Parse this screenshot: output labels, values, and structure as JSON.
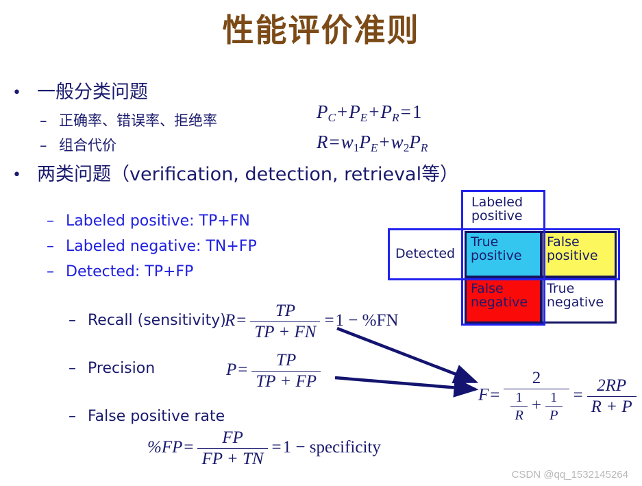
{
  "slide": {
    "title": "性能评价准则",
    "title_color": "#7b4a17",
    "body_color": "#1a1a6e",
    "accent_blue": "#2020e0"
  },
  "bullets": {
    "level1": [
      {
        "marker": "•",
        "text": "一般分类问题"
      },
      {
        "marker": "•",
        "text": "两类问题（verification, detection, retrieval等）"
      }
    ],
    "group_a": [
      {
        "marker": "–",
        "text": "正确率、错误率、拒绝率"
      },
      {
        "marker": "–",
        "text": "组合代价"
      }
    ],
    "group_b": [
      {
        "marker": "–",
        "text": "Labeled positive: TP+FN"
      },
      {
        "marker": "–",
        "text": "Labeled negative: TN+FP"
      },
      {
        "marker": "–",
        "text": "Detected: TP+FP"
      }
    ],
    "group_c": [
      {
        "marker": "–",
        "text": "Recall (sensitivity)"
      },
      {
        "marker": "–",
        "text": "Precision"
      },
      {
        "marker": "–",
        "text": "False positive rate"
      }
    ]
  },
  "formulas": {
    "sum_identity": {
      "lhs1": "P",
      "sub1": "C",
      "lhs2": "P",
      "sub2": "E",
      "lhs3": "P",
      "sub3": "R",
      "rhs": "1",
      "plain": "P_C + P_E + P_R = 1"
    },
    "combined_cost": {
      "lhs": "R",
      "w1": "w",
      "w1sub": "1",
      "p1": "P",
      "p1sub": "E",
      "w2": "w",
      "w2sub": "2",
      "p2": "P",
      "p2sub": "R",
      "plain": "R = w1 P_E + w2 P_R"
    },
    "recall": {
      "lhs": "R",
      "num": "TP",
      "den": "TP + FN",
      "tail": "1 − %FN",
      "plain": "R = TP / (TP + FN) = 1 - %FN"
    },
    "precision": {
      "lhs": "P",
      "num": "TP",
      "den": "TP + FP",
      "plain": "P = TP / (TP + FP)"
    },
    "fmeasure": {
      "lhs": "F",
      "num1": "2",
      "den1_a_num": "1",
      "den1_a_den": "R",
      "den1_b_num": "1",
      "den1_b_den": "P",
      "num2": "2RP",
      "den2": "R + P",
      "plain": "F = 2 / (1/R + 1/P) = 2RP / (R + P)"
    },
    "false_positive_rate": {
      "lhs": "%FP",
      "num": "FP",
      "den": "FP + TN",
      "tail": "1 − specificity",
      "plain": "%FP = FP / (FP + TN) = 1 - specificity"
    }
  },
  "matrix": {
    "row_header": "Detected",
    "col_header": "Labeled positive",
    "cells": [
      {
        "id": "true-positive",
        "label": "True positive",
        "color": "#34c6ef"
      },
      {
        "id": "false-positive",
        "label": "False positive",
        "color": "#fbf75c"
      },
      {
        "id": "false-negative",
        "label": "False negative",
        "color": "#fb0a0a"
      },
      {
        "id": "true-negative",
        "label": "True negative",
        "color": "#ffffff"
      }
    ]
  },
  "watermark": "CSDN @qq_1532145264"
}
